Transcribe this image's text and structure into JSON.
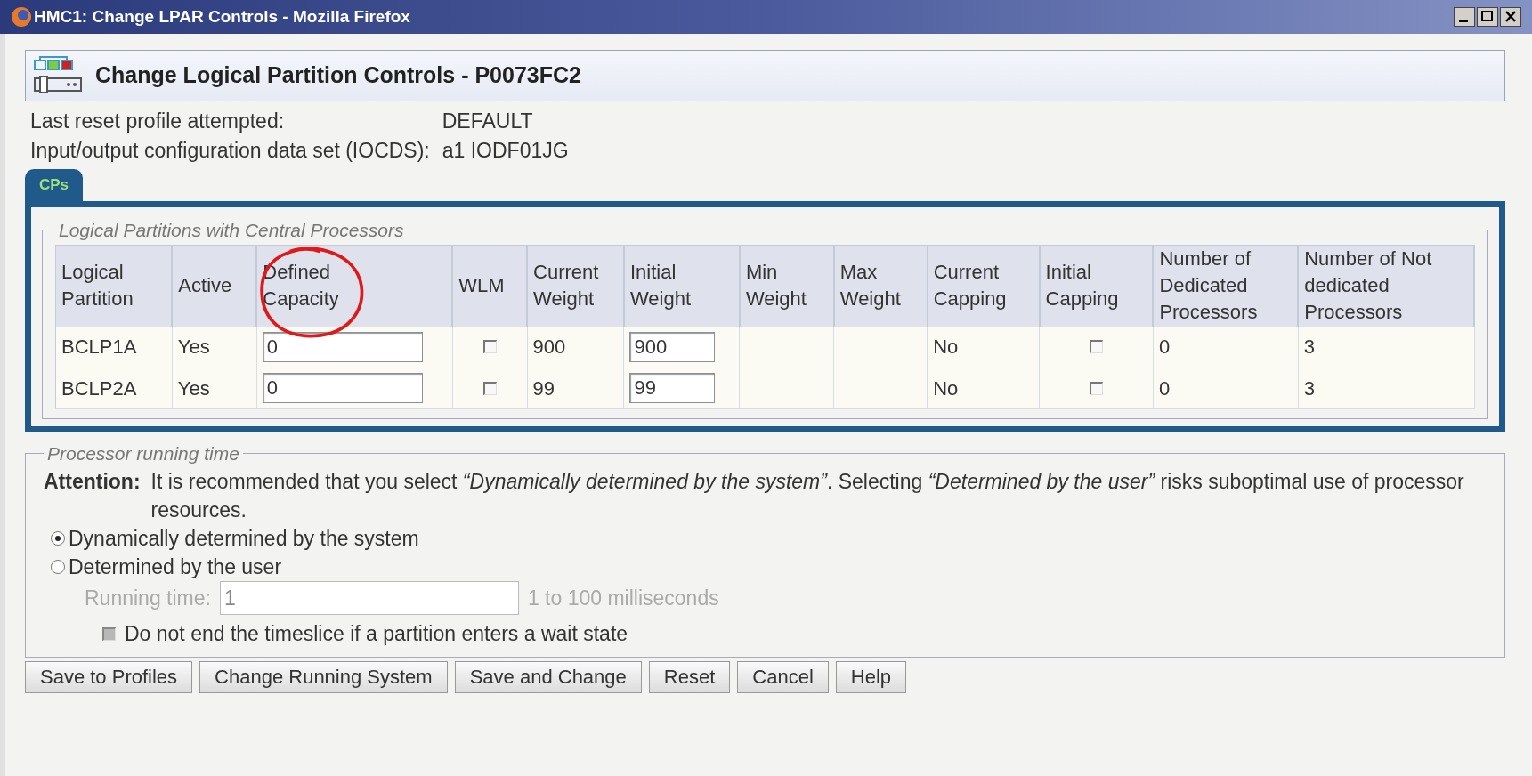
{
  "window": {
    "title": "HMC1: Change LPAR Controls - Mozilla Firefox"
  },
  "header": {
    "title": "Change Logical Partition Controls - P0073FC2"
  },
  "info": [
    {
      "label": "Last reset profile attempted:",
      "value": "DEFAULT"
    },
    {
      "label": "Input/output configuration data set (IOCDS):",
      "value": "a1 IODF01JG"
    }
  ],
  "tabs": [
    {
      "label": "CPs",
      "selected": true
    }
  ],
  "partitions": {
    "legend": "Logical Partitions with Central Processors",
    "columns": [
      "Logical Partition",
      "Active",
      "Defined Capacity",
      "WLM",
      "Current Weight",
      "Initial Weight",
      "Min Weight",
      "Max Weight",
      "Current Capping",
      "Initial Capping",
      "Number of Dedicated Processors",
      "Number of Not dedicated Processors"
    ],
    "rows": [
      {
        "partition": "BCLP1A",
        "active": "Yes",
        "defined_capacity": "0",
        "wlm": false,
        "current_weight": "900",
        "initial_weight": "900",
        "current_capping": "No",
        "initial_capping": false,
        "dedicated": "0",
        "not_dedicated": "3"
      },
      {
        "partition": "BCLP2A",
        "active": "Yes",
        "defined_capacity": "0",
        "wlm": false,
        "current_weight": "99",
        "initial_weight": "99",
        "current_capping": "No",
        "initial_capping": false,
        "dedicated": "0",
        "not_dedicated": "3"
      }
    ]
  },
  "running_time": {
    "legend": "Processor running time",
    "attention_label": "Attention:",
    "attention_text": "It is recommended that you select *“Dynamically determined by the system”*. Selecting *“Determined by the user”* risks suboptimal use of processor resources.",
    "options": [
      {
        "label": "Dynamically determined by the system",
        "selected": true
      },
      {
        "label": "Determined by the user",
        "selected": false
      }
    ],
    "field": {
      "label": "Running time:",
      "value": "1",
      "hint": "1 to 100 milliseconds",
      "disabled": true
    },
    "checkbox": {
      "label": "Do not end the timeslice if a partition enters a wait state",
      "checked": false,
      "disabled": true
    }
  },
  "buttons": [
    "Save to Profiles",
    "Change Running System",
    "Save and Change",
    "Reset",
    "Cancel",
    "Help"
  ]
}
